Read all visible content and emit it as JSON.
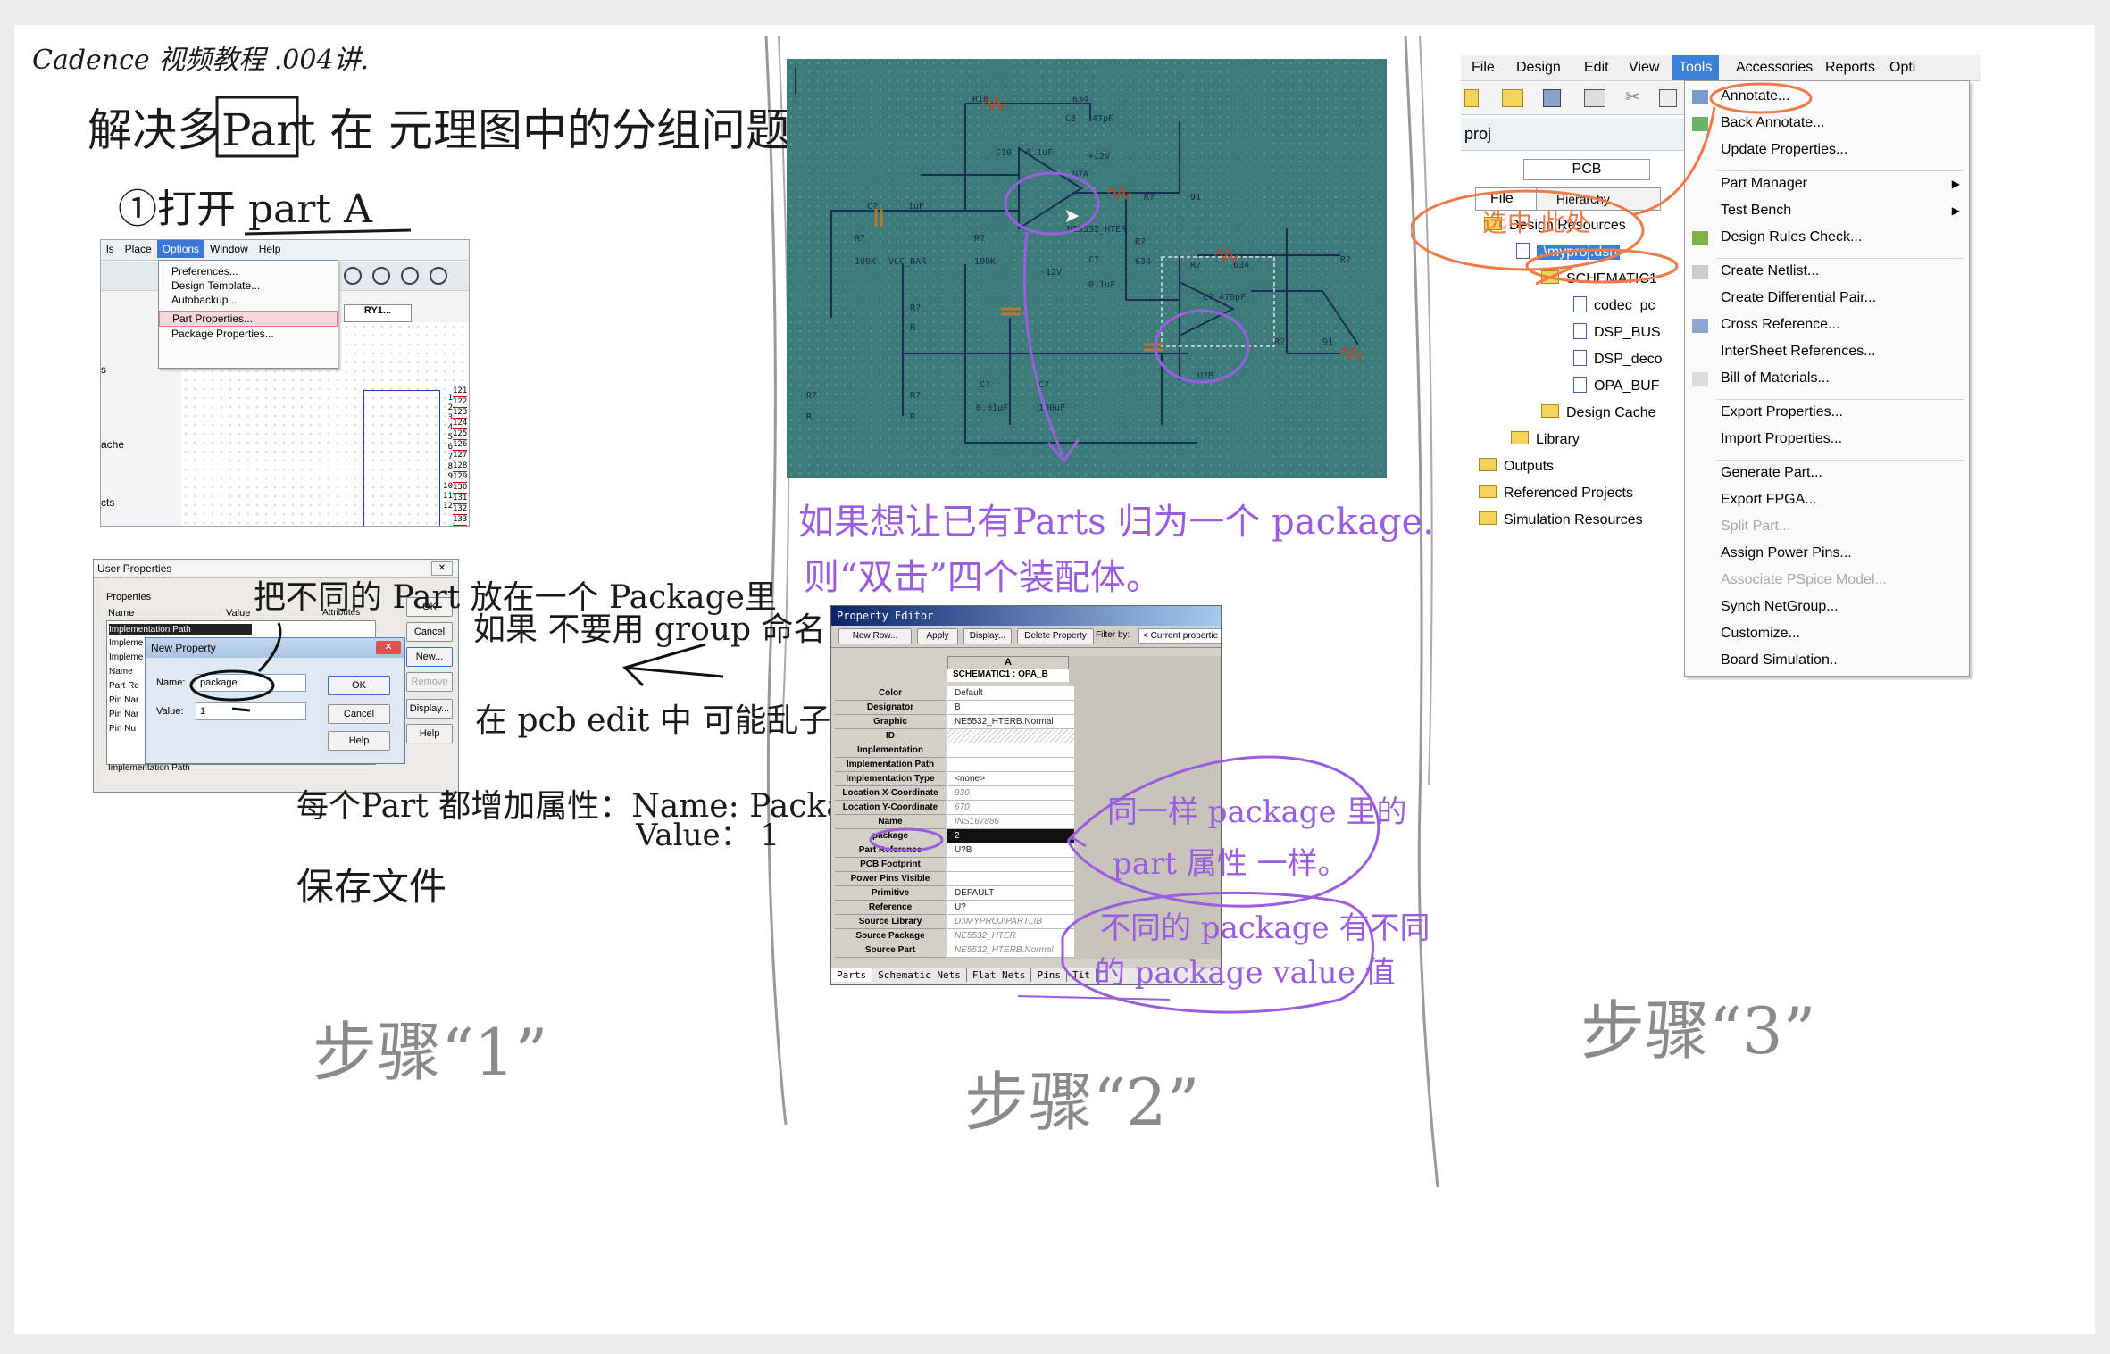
{
  "notes": {
    "title_line": "Cadence 视频教程 .004讲.",
    "heading": "解决多Part 在 元理图中的分组问题",
    "step1": "①打开 part A",
    "side1": "把不同的 Part 放在一个 Package里",
    "side2": "如果 不要用 group 命名",
    "side3": "在 pcb edit 中 可能乱子",
    "mid1": "每个Part 都增加属性：Name: Package",
    "mid2": "Value： 1",
    "mid3": "保存文件",
    "purple1": "如果想让已有Parts 归为一个 package.",
    "purple2": "则“双击”四个装配体。",
    "purple3": "同一样 package 里的",
    "purple4": "part 属性 一样。",
    "purple5": "不同的 package 有不同",
    "purple6": "的 package value 值",
    "red_note": "选中 此处",
    "step_a": "步骤“1”",
    "step_b": "步骤“2”",
    "step_c": "步骤“3”"
  },
  "shot1": {
    "menu": [
      "ls",
      "Place",
      "Options",
      "Window",
      "Help"
    ],
    "dropdown": [
      "Preferences...",
      "Design Template...",
      "Autobackup...",
      "Part Properties...",
      "Package Properties..."
    ],
    "tab": "RY1...",
    "side_labels": [
      "s",
      "ache",
      "cts"
    ],
    "pin_numbers": [
      "1",
      "2",
      "3",
      "4",
      "5",
      "6",
      "7",
      "8",
      "9",
      "10",
      "11",
      "12"
    ],
    "pin_values": [
      "121",
      "122",
      "123",
      "124",
      "125",
      "126",
      "127",
      "128",
      "129",
      "130",
      "131",
      "132",
      "133"
    ]
  },
  "dialog": {
    "title": "User Properties",
    "props_label": "Properties",
    "col_name": "Name",
    "col_value": "Value",
    "col_attr": "Attributes",
    "rows": [
      "Implementation Path",
      "Impleme",
      "Impleme",
      "Name",
      "Part Re",
      "Pin Nar",
      "Pin Nar",
      "Pin Nu"
    ],
    "bottom": "Implementation Path",
    "buttons": [
      "OK",
      "Cancel",
      "New...",
      "Remove",
      "Display...",
      "Help"
    ],
    "new_prop": {
      "title": "New Property",
      "name_label": "Name:",
      "name_value": "package",
      "value_label": "Value:",
      "value_value": "1",
      "ok": "OK",
      "cancel": "Cancel",
      "help": "Help"
    }
  },
  "schematic": {
    "labels": [
      "R10",
      "634",
      "C8",
      "47pF",
      "C10",
      "0.1uF",
      "+12V",
      "U?A",
      "R?",
      "91",
      "C?",
      "1uF",
      "R?",
      "100K",
      "VCC_BAR",
      "R?",
      "100K",
      "-12V",
      "C?",
      "0.1uF",
      "R?",
      "634",
      "NE5532_HTER",
      "R?",
      "R",
      "R?",
      "R",
      "C?",
      "0.01uF",
      "C?",
      "100uF",
      "R?",
      "R",
      "R?",
      "634",
      "C?",
      "470pF",
      "R?",
      "91",
      "U?B",
      "R?"
    ]
  },
  "prop_editor": {
    "title": "Property Editor",
    "toolbar": [
      "New Row...",
      "Apply",
      "Display...",
      "Delete Property",
      "Filter by:",
      "< Current propertie"
    ],
    "col_letter": "A",
    "header_cell": "SCHEMATIC1 : OPA_B",
    "rows": [
      {
        "name": "Color",
        "value": "Default"
      },
      {
        "name": "Designator",
        "value": "B"
      },
      {
        "name": "Graphic",
        "value": "NE5532_HTERB.Normal"
      },
      {
        "name": "ID",
        "value": ""
      },
      {
        "name": "Implementation",
        "value": ""
      },
      {
        "name": "Implementation Path",
        "value": ""
      },
      {
        "name": "Implementation Type",
        "value": "<none>"
      },
      {
        "name": "Location X-Coordinate",
        "value": "930"
      },
      {
        "name": "Location Y-Coordinate",
        "value": "670"
      },
      {
        "name": "Name",
        "value": "INS167886"
      },
      {
        "name": "package",
        "value": "2"
      },
      {
        "name": "Part Reference",
        "value": "U?B"
      },
      {
        "name": "PCB Footprint",
        "value": ""
      },
      {
        "name": "Power Pins Visible",
        "value": ""
      },
      {
        "name": "Primitive",
        "value": "DEFAULT"
      },
      {
        "name": "Reference",
        "value": "U?"
      },
      {
        "name": "Source Library",
        "value": "D:\\MYPROJ\\PARTLIB"
      },
      {
        "name": "Source Package",
        "value": "NE5532_HTER"
      },
      {
        "name": "Source Part",
        "value": "NE5532_HTERB.Normal"
      }
    ],
    "tabs": [
      "Parts",
      "Schematic Nets",
      "Flat Nets",
      "Pins",
      "Tit"
    ]
  },
  "tools": {
    "menu": [
      "File",
      "Design",
      "Edit",
      "View",
      "Tools",
      "Accessories",
      "Reports",
      "Opti"
    ],
    "tree_title": "proj",
    "tab_pcb": "PCB",
    "tab_file": "File",
    "tab_hier": "Hierarchy",
    "tree": [
      "Design Resources",
      ".\\myproj.dsn",
      "SCHEMATIC1",
      "codec_pc",
      "DSP_BUS",
      "DSP_deco",
      "OPA_BUF",
      "Design Cache",
      "Library",
      "Outputs",
      "Referenced Projects",
      "Simulation Resources"
    ],
    "items": [
      "Annotate...",
      "Back Annotate...",
      "Update Properties...",
      "Part Manager",
      "Test Bench",
      "Design Rules Check...",
      "Create Netlist...",
      "Create Differential Pair...",
      "Cross Reference...",
      "InterSheet References...",
      "Bill of Materials...",
      "Export Properties...",
      "Import Properties...",
      "Generate Part...",
      "Export FPGA...",
      "Split Part...",
      "Assign Power Pins...",
      "Associate PSpice Model...",
      "Synch NetGroup...",
      "Customize...",
      "Board Simulation.."
    ]
  },
  "colors": {
    "purple": "#9b5de0",
    "orange": "#f07a48",
    "teal": "#3d7b7a",
    "menu_blue": "#3c7fd6"
  }
}
